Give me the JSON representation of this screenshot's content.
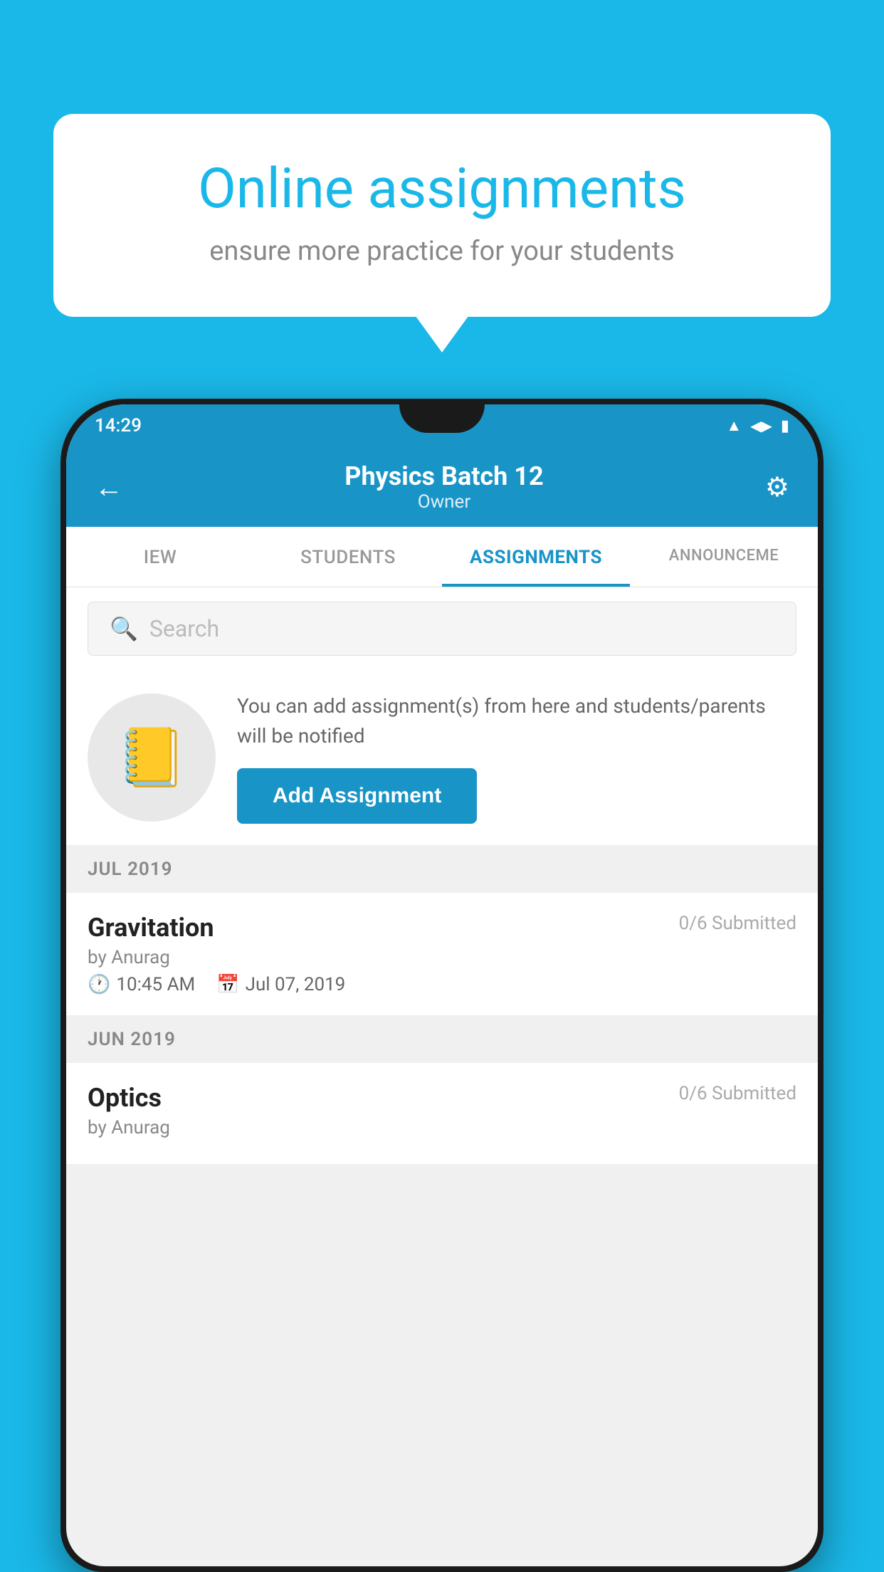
{
  "background_color": "#1ab8e8",
  "speech_bubble": {
    "title": "Online assignments",
    "subtitle": "ensure more practice for your students"
  },
  "status_bar": {
    "time": "14:29",
    "icons": [
      "wifi",
      "signal",
      "battery"
    ]
  },
  "header": {
    "title": "Physics Batch 12",
    "subtitle": "Owner",
    "back_label": "←",
    "gear_label": "⚙"
  },
  "tabs": [
    {
      "label": "IEW",
      "active": false
    },
    {
      "label": "STUDENTS",
      "active": false
    },
    {
      "label": "ASSIGNMENTS",
      "active": true
    },
    {
      "label": "ANNOUNCEME",
      "active": false
    }
  ],
  "search": {
    "placeholder": "Search"
  },
  "promo": {
    "icon": "📓",
    "text": "You can add assignment(s) from here and students/parents will be notified",
    "button_label": "Add Assignment"
  },
  "sections": [
    {
      "month_label": "JUL 2019",
      "assignments": [
        {
          "name": "Gravitation",
          "submitted": "0/6 Submitted",
          "by": "by Anurag",
          "time": "10:45 AM",
          "date": "Jul 07, 2019"
        }
      ]
    },
    {
      "month_label": "JUN 2019",
      "assignments": [
        {
          "name": "Optics",
          "submitted": "0/6 Submitted",
          "by": "by Anurag",
          "time": "",
          "date": ""
        }
      ]
    }
  ]
}
